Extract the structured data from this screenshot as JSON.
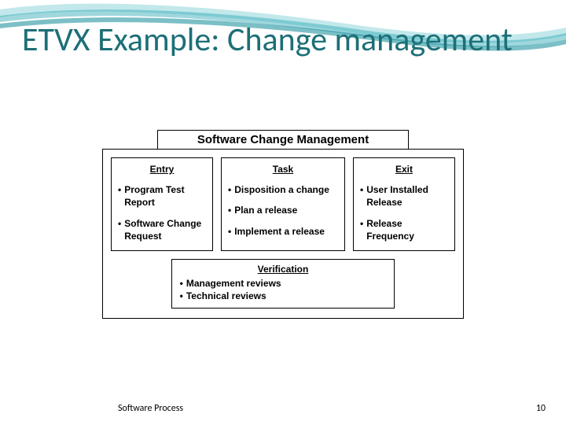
{
  "title": "ETVX Example: Change management",
  "diagram": {
    "header": "Software Change Management",
    "columns": [
      {
        "heading": "Entry",
        "items": [
          "Program Test Report",
          "Software Change Request"
        ]
      },
      {
        "heading": "Task",
        "items": [
          "Disposition a change",
          "Plan a release",
          "Implement a release"
        ]
      },
      {
        "heading": "Exit",
        "items": [
          "User Installed Release",
          "Release Frequency"
        ]
      }
    ],
    "verification": {
      "heading": "Verification",
      "items": [
        "Management reviews",
        "Technical reviews"
      ]
    }
  },
  "footer": {
    "left": "Software Process",
    "right": "10"
  }
}
